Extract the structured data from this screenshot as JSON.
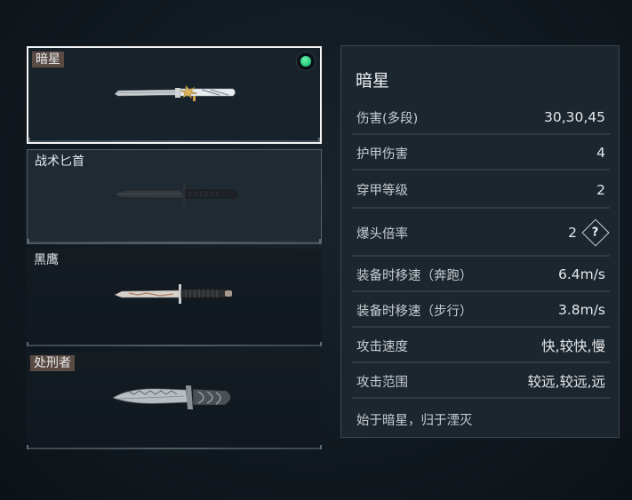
{
  "weapons": [
    {
      "name": "暗星",
      "icon": "knife-darkstar-icon",
      "equipped": true
    },
    {
      "name": "战术匕首",
      "icon": "tactical-dagger-icon",
      "equipped": false
    },
    {
      "name": "黑鹰",
      "icon": "blackhawk-knife-icon",
      "equipped": false
    },
    {
      "name": "处刑者",
      "icon": "executioner-knife-icon",
      "equipped": false
    }
  ],
  "detail": {
    "title": "暗星",
    "stats": [
      {
        "label": "伤害(多段)",
        "value": "30,30,45"
      },
      {
        "label": "护甲伤害",
        "value": "4"
      },
      {
        "label": "穿甲等级",
        "value": "2"
      },
      {
        "label": "爆头倍率",
        "value": "2"
      },
      {
        "label": "装备时移速（奔跑）",
        "value": "6.4m/s"
      },
      {
        "label": "装备时移速（步行）",
        "value": "3.8m/s"
      },
      {
        "label": "攻击速度",
        "value": "快,较快,慢"
      },
      {
        "label": "攻击范围",
        "value": "较远,较远,远"
      }
    ],
    "help_glyph": "?",
    "description": "始于暗星，归于湮灭"
  },
  "colors": {
    "equipped": "#1fc77b",
    "selected_border": "#f2f4f5",
    "panel_bg": "#1c262e"
  }
}
